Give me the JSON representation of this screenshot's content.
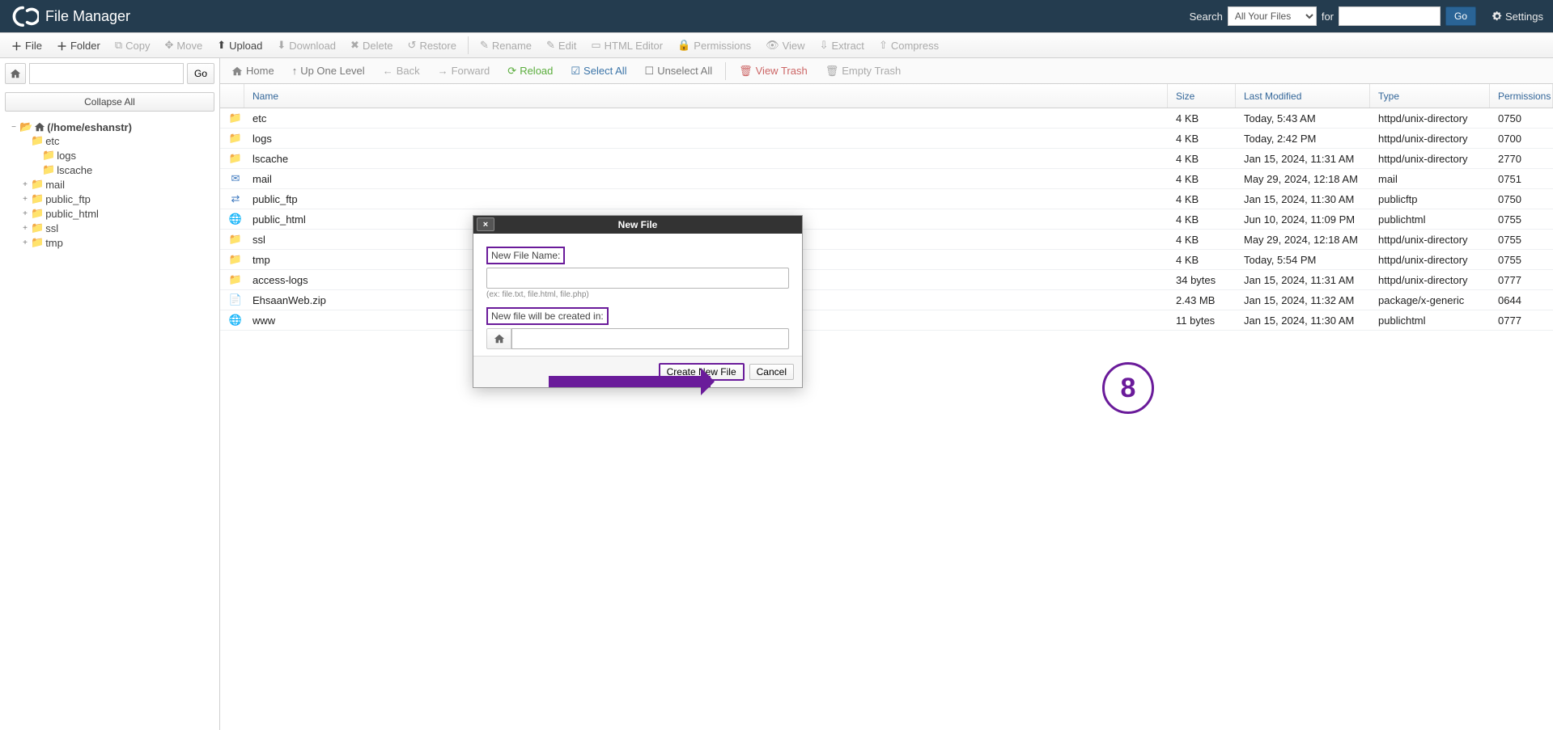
{
  "topbar": {
    "title": "File Manager",
    "search_label": "Search",
    "search_scope": "All Your Files",
    "for_label": "for",
    "search_value": "",
    "go_label": "Go",
    "settings_label": "Settings"
  },
  "toolbar": {
    "file": "File",
    "folder": "Folder",
    "copy": "Copy",
    "move": "Move",
    "upload": "Upload",
    "download": "Download",
    "delete": "Delete",
    "restore": "Restore",
    "rename": "Rename",
    "edit": "Edit",
    "html_editor": "HTML Editor",
    "permissions": "Permissions",
    "view": "View",
    "extract": "Extract",
    "compress": "Compress"
  },
  "sidebar": {
    "path_value": "",
    "go_label": "Go",
    "collapse_label": "Collapse All",
    "root_label": "(/home/eshanstr)",
    "tree": [
      {
        "label": "etc",
        "expandable": false
      },
      {
        "label": "logs",
        "expandable": false,
        "indent": 2
      },
      {
        "label": "lscache",
        "expandable": false,
        "indent": 2
      },
      {
        "label": "mail",
        "expandable": true
      },
      {
        "label": "public_ftp",
        "expandable": true
      },
      {
        "label": "public_html",
        "expandable": true
      },
      {
        "label": "ssl",
        "expandable": true
      },
      {
        "label": "tmp",
        "expandable": true
      }
    ]
  },
  "nav": {
    "home": "Home",
    "up": "Up One Level",
    "back": "Back",
    "forward": "Forward",
    "reload": "Reload",
    "select_all": "Select All",
    "unselect_all": "Unselect All",
    "view_trash": "View Trash",
    "empty_trash": "Empty Trash"
  },
  "columns": {
    "name": "Name",
    "size": "Size",
    "modified": "Last Modified",
    "type": "Type",
    "perm": "Permissions"
  },
  "rows": [
    {
      "icon": "folder",
      "name": "etc",
      "size": "4 KB",
      "modified": "Today, 5:43 AM",
      "type": "httpd/unix-directory",
      "perm": "0750"
    },
    {
      "icon": "folder",
      "name": "logs",
      "size": "4 KB",
      "modified": "Today, 2:42 PM",
      "type": "httpd/unix-directory",
      "perm": "0700"
    },
    {
      "icon": "folder",
      "name": "lscache",
      "size": "4 KB",
      "modified": "Jan 15, 2024, 11:31 AM",
      "type": "httpd/unix-directory",
      "perm": "2770"
    },
    {
      "icon": "mail",
      "name": "mail",
      "size": "4 KB",
      "modified": "May 29, 2024, 12:18 AM",
      "type": "mail",
      "perm": "0751"
    },
    {
      "icon": "swap",
      "name": "public_ftp",
      "size": "4 KB",
      "modified": "Jan 15, 2024, 11:30 AM",
      "type": "publicftp",
      "perm": "0750"
    },
    {
      "icon": "globe",
      "name": "public_html",
      "size": "4 KB",
      "modified": "Jun 10, 2024, 11:09 PM",
      "type": "publichtml",
      "perm": "0755"
    },
    {
      "icon": "folder",
      "name": "ssl",
      "size": "4 KB",
      "modified": "May 29, 2024, 12:18 AM",
      "type": "httpd/unix-directory",
      "perm": "0755"
    },
    {
      "icon": "folder",
      "name": "tmp",
      "size": "4 KB",
      "modified": "Today, 5:54 PM",
      "type": "httpd/unix-directory",
      "perm": "0755"
    },
    {
      "icon": "link",
      "name": "access-logs",
      "size": "34 bytes",
      "modified": "Jan 15, 2024, 11:31 AM",
      "type": "httpd/unix-directory",
      "perm": "0777"
    },
    {
      "icon": "file",
      "name": "EhsaanWeb.zip",
      "size": "2.43 MB",
      "modified": "Jan 15, 2024, 11:32 AM",
      "type": "package/x-generic",
      "perm": "0644"
    },
    {
      "icon": "globe",
      "name": "www",
      "size": "11 bytes",
      "modified": "Jan 15, 2024, 11:30 AM",
      "type": "publichtml",
      "perm": "0777"
    }
  ],
  "modal": {
    "title": "New File",
    "name_label": "New File Name:",
    "name_value": "",
    "hint": "(ex: file.txt, file.html, file.php)",
    "location_label": "New file will be created in:",
    "location_value": "",
    "create_label": "Create New File",
    "cancel_label": "Cancel"
  },
  "annotation": {
    "step_number": "8"
  }
}
